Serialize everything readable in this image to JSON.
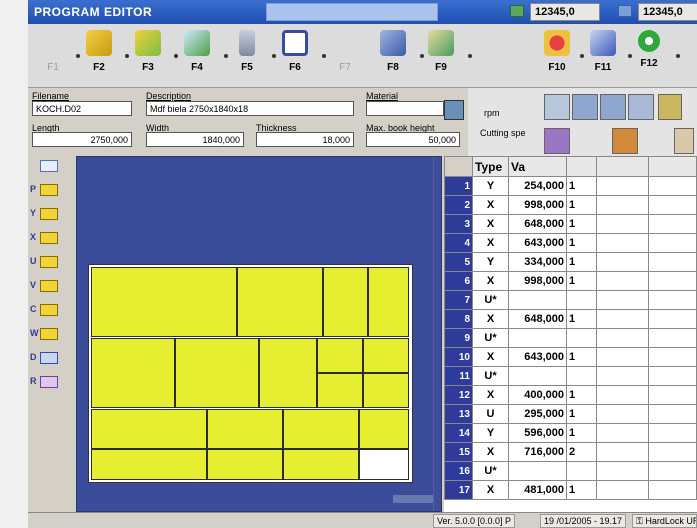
{
  "window": {
    "title": "PROGRAM EDITOR"
  },
  "counters": [
    {
      "value": "12345,0"
    },
    {
      "value": "12345,0"
    }
  ],
  "toolbar": {
    "left_keys": [
      "F1",
      "F2",
      "F3",
      "F4",
      "F5",
      "F6",
      "F7",
      "F8",
      "F9"
    ],
    "right_keys": [
      "F10",
      "F11",
      "F12"
    ]
  },
  "form": {
    "filename_label": "Filename",
    "filename": "KOCH.D02",
    "description_label": "Description",
    "description": "Mdf biela 2750x1840x18",
    "material_label": "Material",
    "material": "",
    "length_label": "Length",
    "length": "2750,000",
    "width_label": "Width",
    "width": "1840,000",
    "thickness_label": "Thickness",
    "thickness": "18,000",
    "max_book_height_label": "Max. book height",
    "max_book_height": "50,000"
  },
  "rpanel": {
    "rpm": "rpm",
    "cutting": "Cutting spe"
  },
  "vtools": [
    "",
    "P",
    "Y",
    "X",
    "U",
    "V",
    "C",
    "W",
    "D",
    "R"
  ],
  "grid": {
    "headers": [
      "Type",
      "Va"
    ],
    "rows": [
      {
        "n": "1",
        "type": "Y",
        "val": "254,000",
        "rep": "1"
      },
      {
        "n": "2",
        "type": "X",
        "val": "998,000",
        "rep": "1"
      },
      {
        "n": "3",
        "type": "X",
        "val": "648,000",
        "rep": "1"
      },
      {
        "n": "4",
        "type": "X",
        "val": "643,000",
        "rep": "1"
      },
      {
        "n": "5",
        "type": "Y",
        "val": "334,000",
        "rep": "1"
      },
      {
        "n": "6",
        "type": "X",
        "val": "998,000",
        "rep": "1"
      },
      {
        "n": "7",
        "type": "U*",
        "val": "",
        "rep": ""
      },
      {
        "n": "8",
        "type": "X",
        "val": "648,000",
        "rep": "1"
      },
      {
        "n": "9",
        "type": "U*",
        "val": "",
        "rep": ""
      },
      {
        "n": "10",
        "type": "X",
        "val": "643,000",
        "rep": "1"
      },
      {
        "n": "11",
        "type": "U*",
        "val": "",
        "rep": ""
      },
      {
        "n": "12",
        "type": "X",
        "val": "400,000",
        "rep": "1"
      },
      {
        "n": "13",
        "type": "U",
        "val": "295,000",
        "rep": "1"
      },
      {
        "n": "14",
        "type": "Y",
        "val": "596,000",
        "rep": "1"
      },
      {
        "n": "15",
        "type": "X",
        "val": "716,000",
        "rep": "2"
      },
      {
        "n": "16",
        "type": "U*",
        "val": "",
        "rep": ""
      },
      {
        "n": "17",
        "type": "X",
        "val": "481,000",
        "rep": "1"
      }
    ]
  },
  "status": {
    "version": "Ver. 5.0.0 [0.0.0] P",
    "datetime": "19 /01/2005 - 19.17",
    "lock": "HardLock UR"
  }
}
